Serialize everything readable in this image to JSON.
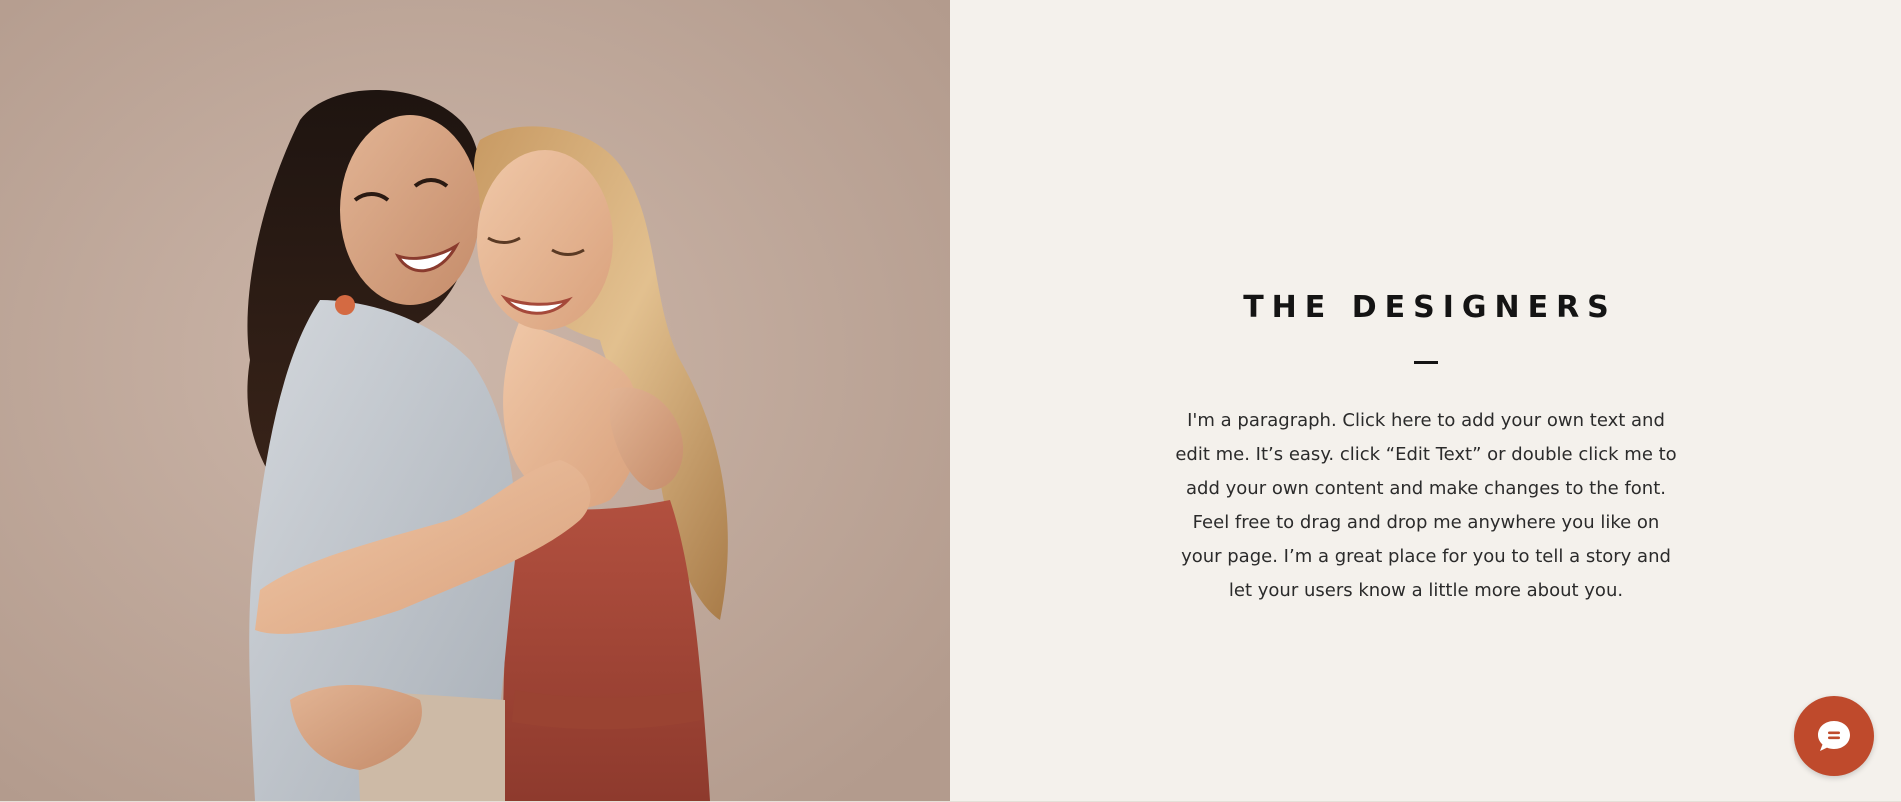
{
  "hero": {
    "image_alt": "Two smiling women hugging",
    "heading": "THE DESIGNERS",
    "paragraph_lines": [
      "I'm a paragraph. Click here to add your own text and",
      "edit me. It’s easy. click “Edit Text” or double click me to",
      "add your own content and make changes to the font.",
      "Feel free to drag and drop me anywhere you like on",
      "your page. I’m a great place for you to tell a story and",
      "let your users know a little more about you."
    ]
  },
  "chat": {
    "icon": "chat-bubble-icon",
    "color": "#bf4a2c"
  },
  "colors": {
    "panel_background": "#f4f1ec",
    "heading": "#141414",
    "text": "#2b2b2b"
  }
}
